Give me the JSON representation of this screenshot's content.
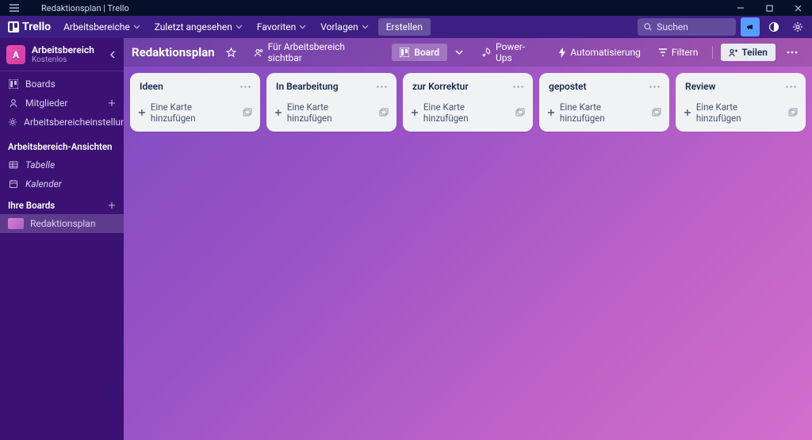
{
  "window": {
    "title": "Redaktionsplan | Trello"
  },
  "nav": {
    "brand": "Trello",
    "items": [
      {
        "label": "Arbeitsbereiche"
      },
      {
        "label": "Zuletzt angesehen"
      },
      {
        "label": "Favoriten"
      },
      {
        "label": "Vorlagen"
      }
    ],
    "create": "Erstellen",
    "search_placeholder": "Suchen"
  },
  "sidebar": {
    "workspace": {
      "letter": "A",
      "name": "Arbeitsbereich",
      "plan": "Kostenlos"
    },
    "primary": [
      {
        "icon": "board",
        "label": "Boards"
      },
      {
        "icon": "members",
        "label": "Mitglieder",
        "add": true
      },
      {
        "icon": "gear",
        "label": "Arbeitsbereicheinstellungen"
      }
    ],
    "views_heading": "Arbeitsbereich-Ansichten",
    "views": [
      {
        "icon": "table",
        "label": "Tabelle"
      },
      {
        "icon": "calendar",
        "label": "Kalender"
      }
    ],
    "boards_heading": "Ihre Boards",
    "boards": [
      {
        "label": "Redaktionsplan"
      }
    ]
  },
  "board": {
    "title": "Redaktionsplan",
    "visibility": "Für Arbeitsbereich sichtbar",
    "view_label": "Board",
    "buttons": {
      "powerups": "Power-Ups",
      "automation": "Automatisierung",
      "filters": "Filtern",
      "share": "Teilen"
    },
    "add_card": "Eine Karte hinzufügen",
    "lists": [
      {
        "title": "Ideen"
      },
      {
        "title": "In Bearbeitung"
      },
      {
        "title": "zur Korrektur"
      },
      {
        "title": "gepostet"
      },
      {
        "title": "Review"
      }
    ]
  }
}
